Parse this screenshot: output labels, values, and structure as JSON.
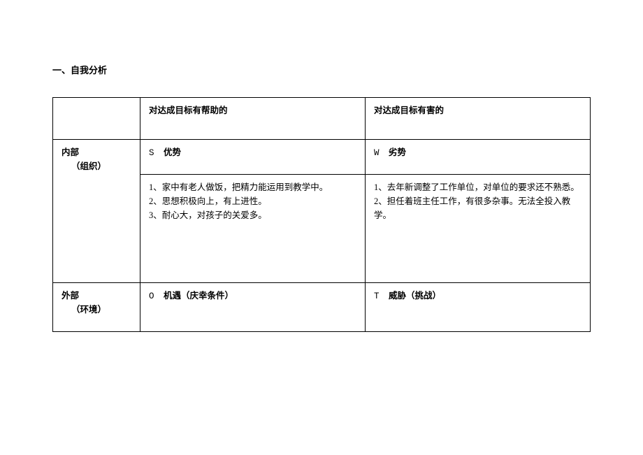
{
  "title": "一、自我分析",
  "headers": {
    "blank": "",
    "helpful": "对达成目标有帮助的",
    "harmful": "对达成目标有害的"
  },
  "internal": {
    "label_main": "内部",
    "label_sub": "（组织）",
    "strength_code": "S",
    "strength_label": "优势",
    "weakness_code": "W",
    "weakness_label": "劣势",
    "strength_content": "1、家中有老人做饭，把精力能运用到教学中。\n2、思想积极向上，有上进性。\n3、耐心大，对孩子的关爱多。",
    "weakness_content": "1、去年新调整了工作单位，对单位的要求还不熟悉。\n2、担任着班主任工作，有很多杂事。无法全投入教学。"
  },
  "external": {
    "label_main": "外部",
    "label_sub": "（环境）",
    "opportunity_code": "O",
    "opportunity_label": "机遇（庆幸条件）",
    "threat_code": "T",
    "threat_label": "威胁（挑战）"
  }
}
